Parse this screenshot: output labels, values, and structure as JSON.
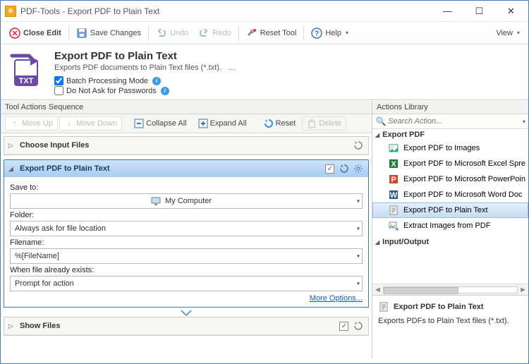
{
  "window": {
    "title": "PDF-Tools - Export PDF to Plain Text"
  },
  "toolbar": {
    "close_edit": "Close Edit",
    "save_changes": "Save Changes",
    "undo": "Undo",
    "redo": "Redo",
    "reset_tool": "Reset Tool",
    "help": "Help",
    "view": "View"
  },
  "header": {
    "title": "Export PDF to Plain Text",
    "subtitle": "Exports PDF documents to Plain Text files (*.txt).",
    "ellipsis": "...",
    "batch_label": "Batch Processing Mode",
    "noask_label": "Do Not Ask for Passwords"
  },
  "leftpanel": {
    "title": "Tool Actions Sequence",
    "move_up": "Move Up",
    "move_down": "Move Down",
    "collapse_all": "Collapse All",
    "expand_all": "Expand All",
    "reset": "Reset",
    "delete": "Delete"
  },
  "acc_input": {
    "title": "Choose Input Files"
  },
  "acc_export": {
    "title": "Export PDF to Plain Text",
    "save_to_label": "Save to:",
    "save_to_value": "My Computer",
    "folder_label": "Folder:",
    "folder_value": "Always ask for file location",
    "filename_label": "Filename:",
    "filename_value": "%[FileName]",
    "exists_label": "When file already exists:",
    "exists_value": "Prompt for action",
    "more_options": "More Options..."
  },
  "acc_show": {
    "title": "Show Files"
  },
  "rightpanel": {
    "title": "Actions Library",
    "search_placeholder": "Search Action...",
    "group_export": "Export PDF",
    "items": [
      "Export PDF to Images",
      "Export PDF to Microsoft Excel Spre",
      "Export PDF to Microsoft PowerPoin",
      "Export PDF to Microsoft Word Doc",
      "Export PDF to Plain Text",
      "Extract Images from PDF"
    ],
    "group_io": "Input/Output"
  },
  "desc": {
    "title": "Export PDF to Plain Text",
    "body": "Exports PDFs to Plain Text files (*.txt)."
  }
}
